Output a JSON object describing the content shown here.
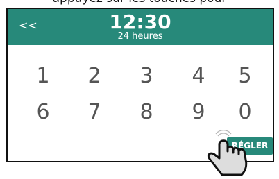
{
  "caption": "appuyez sur les touches pour",
  "header": {
    "back_label": "<<",
    "time": "12:30",
    "format_label": "24 heures",
    "color": "#27897a"
  },
  "keypad": {
    "row1": [
      "1",
      "2",
      "3",
      "4",
      "5"
    ],
    "row2": [
      "6",
      "7",
      "8",
      "9",
      "0"
    ]
  },
  "set_button": {
    "label": "RÉGLER"
  },
  "icons": {
    "pointer": "hand-pointer-icon"
  }
}
